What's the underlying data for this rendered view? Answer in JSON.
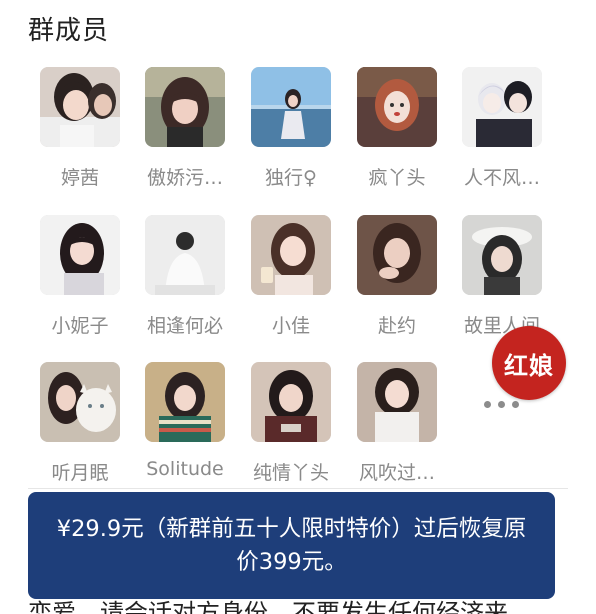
{
  "section": {
    "title": "群成员"
  },
  "members": [
    {
      "name": "婷茜",
      "avatar": "avatar-photo-girl-selfie"
    },
    {
      "name": "傲娇污…",
      "avatar": "avatar-photo-girl-bangs"
    },
    {
      "name": "独行♀",
      "avatar": "avatar-photo-girl-beach"
    },
    {
      "name": "疯丫头",
      "avatar": "avatar-photo-girl-art"
    },
    {
      "name": "人不风…",
      "avatar": "avatar-anime-couple"
    },
    {
      "name": "小妮子",
      "avatar": "avatar-photo-girl-long-hair"
    },
    {
      "name": "相逢何必",
      "avatar": "avatar-photo-person-back"
    },
    {
      "name": "小佳",
      "avatar": "avatar-illustration-girl-cup"
    },
    {
      "name": "赴约",
      "avatar": "avatar-photo-girl-hand"
    },
    {
      "name": "故里人间",
      "avatar": "avatar-photo-girl-hat"
    },
    {
      "name": "听月眠",
      "avatar": "avatar-photo-girl-cat"
    },
    {
      "name": "Solitude",
      "avatar": "avatar-photo-girl-sweater"
    },
    {
      "name": "纯情丫头",
      "avatar": "avatar-photo-girl-tshirt"
    },
    {
      "name": "风吹过…",
      "avatar": "avatar-photo-girl-white"
    }
  ],
  "badge": {
    "label": "红娘"
  },
  "more": {
    "icon": "more-dots-icon"
  },
  "banner": {
    "text": "¥29.9元（新群前五十人限时特价）过后恢复原价399元。"
  },
  "bottom": {
    "text": "恋爱，请会话对方身份，不要发生任何经济来"
  },
  "colors": {
    "banner_bg": "#1e3e7a",
    "badge_bg": "#c4241f",
    "name_text": "#8a8a8a"
  }
}
